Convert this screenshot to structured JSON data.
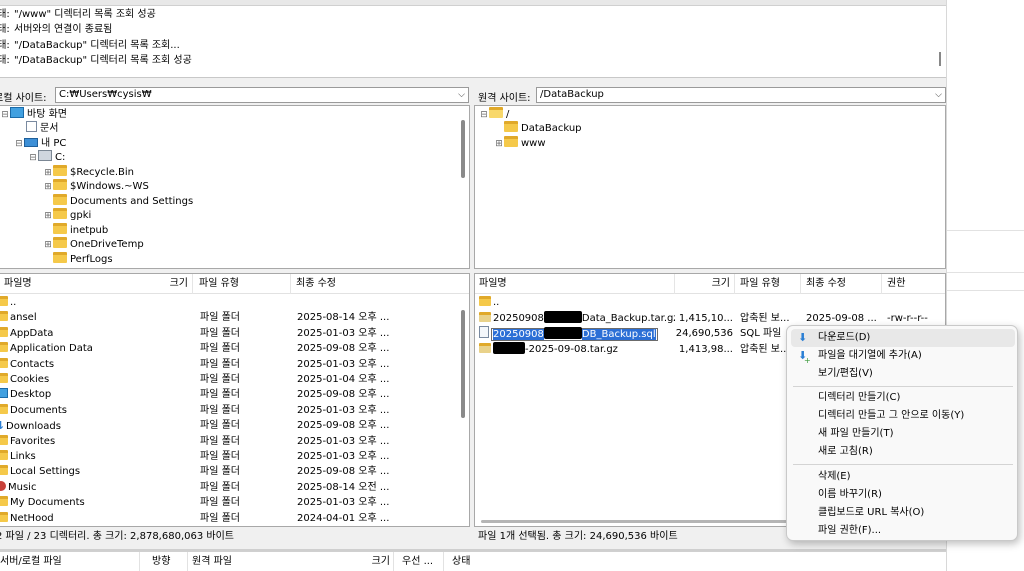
{
  "message_log": {
    "entries": [
      {
        "label": "상태:",
        "text": "\"/www\" 디렉터리 목록 조회 성공"
      },
      {
        "label": "상태:",
        "text": "서버와의 연결이 종료됨"
      },
      {
        "label": "상태:",
        "text": "\"/DataBackup\" 디렉터리 목록 조회..."
      },
      {
        "label": "상태:",
        "text": "\"/DataBackup\" 디렉터리 목록 조회 성공"
      }
    ]
  },
  "local": {
    "site_label": "로컬 사이트:",
    "path": "C:₩Users₩cysis₩",
    "tree": [
      {
        "label": "바탕 화면",
        "icon": "desktop-icon"
      },
      {
        "label": "문서",
        "icon": "document-icon"
      },
      {
        "label": "내 PC",
        "icon": "pc-icon"
      },
      {
        "label": "C:",
        "icon": "drive-icon"
      },
      {
        "label": "$Recycle.Bin",
        "icon": "folder-icon"
      },
      {
        "label": "$Windows.~WS",
        "icon": "folder-icon"
      },
      {
        "label": "Documents and Settings",
        "icon": "folder-shortcut-icon"
      },
      {
        "label": "gpki",
        "icon": "folder-icon"
      },
      {
        "label": "inetpub",
        "icon": "folder-icon"
      },
      {
        "label": "OneDriveTemp",
        "icon": "folder-icon"
      },
      {
        "label": "PerfLogs",
        "icon": "folder-icon"
      }
    ],
    "columns": {
      "name": "파일명",
      "size": "크기",
      "type": "파일 유형",
      "modified": "최종 수정"
    },
    "files": [
      {
        "name": "..",
        "type": "",
        "modified": "",
        "icon": "folder-icon"
      },
      {
        "name": "ansel",
        "type": "파일 폴더",
        "modified": "2025-08-14 오후 ...",
        "icon": "folder-icon"
      },
      {
        "name": "AppData",
        "type": "파일 폴더",
        "modified": "2025-01-03 오후 ...",
        "icon": "folder-icon"
      },
      {
        "name": "Application Data",
        "type": "파일 폴더",
        "modified": "2025-09-08 오후 ...",
        "icon": "folder-icon"
      },
      {
        "name": "Contacts",
        "type": "파일 폴더",
        "modified": "2025-01-03 오후 ...",
        "icon": "folder-icon"
      },
      {
        "name": "Cookies",
        "type": "파일 폴더",
        "modified": "2025-01-04 오후 ...",
        "icon": "folder-icon"
      },
      {
        "name": "Desktop",
        "type": "파일 폴더",
        "modified": "2025-09-08 오후 ...",
        "icon": "desktop-icon"
      },
      {
        "name": "Documents",
        "type": "파일 폴더",
        "modified": "2025-01-03 오후 ...",
        "icon": "folder-icon"
      },
      {
        "name": "Downloads",
        "type": "파일 폴더",
        "modified": "2025-09-08 오후 ...",
        "icon": "download-icon"
      },
      {
        "name": "Favorites",
        "type": "파일 폴더",
        "modified": "2025-01-03 오후 ...",
        "icon": "folder-icon"
      },
      {
        "name": "Links",
        "type": "파일 폴더",
        "modified": "2025-01-03 오후 ...",
        "icon": "folder-icon"
      },
      {
        "name": "Local Settings",
        "type": "파일 폴더",
        "modified": "2025-09-08 오후 ...",
        "icon": "folder-icon"
      },
      {
        "name": "Music",
        "type": "파일 폴더",
        "modified": "2025-08-14 오전 ...",
        "icon": "music-icon"
      },
      {
        "name": "My Documents",
        "type": "파일 폴더",
        "modified": "2025-01-03 오후 ...",
        "icon": "folder-icon"
      },
      {
        "name": "NetHood",
        "type": "파일 폴더",
        "modified": "2024-04-01 오후 ...",
        "icon": "folder-icon"
      }
    ],
    "status": "2 파일 / 23 디렉터리. 총 크기: 2,878,680,063 바이트"
  },
  "remote": {
    "site_label": "원격 사이트:",
    "path": "/DataBackup",
    "tree": [
      {
        "label": "/",
        "icon": "folder-open-icon"
      },
      {
        "label": "DataBackup",
        "icon": "folder-icon"
      },
      {
        "label": "www",
        "icon": "folder-icon"
      }
    ],
    "columns": {
      "name": "파일명",
      "size": "크기",
      "type": "파일 유형",
      "modified": "최종 수정",
      "perms": "권한"
    },
    "files": [
      {
        "name_prefix": "",
        "name_suffix": "..",
        "size": "",
        "type": "",
        "modified": "",
        "perms": "",
        "icon": "folder-icon"
      },
      {
        "name_prefix": "20250908",
        "name_suffix": "Data_Backup.tar.gz",
        "size": "1,415,10...",
        "type": "압축된 보...",
        "modified": "2025-09-08 ...",
        "perms": "-rw-r--r--",
        "icon": "archive-icon"
      },
      {
        "name_prefix": "20250908",
        "name_suffix": "DB_Backup.sql",
        "size": "24,690,536",
        "type": "SQL 파일",
        "modified": "",
        "perms": "",
        "icon": "file-icon"
      },
      {
        "name_prefix": "",
        "name_suffix": "-2025-09-08.tar.gz",
        "size": "1,413,98...",
        "type": "압축된 보...",
        "modified": "",
        "perms": "",
        "icon": "archive-icon"
      }
    ],
    "status": "파일 1개 선택됨. 총 크기: 24,690,536 바이트"
  },
  "queue": {
    "columns": [
      "서버/로컬 파일",
      "방향",
      "원격 파일",
      "크기",
      "우선 ...",
      "상태"
    ]
  },
  "context_menu": {
    "items": [
      {
        "label": "다운로드(D)",
        "icon": "download-arrow-icon"
      },
      {
        "label": "파일을 대기열에 추가(A)",
        "icon": "add-queue-icon"
      },
      {
        "label": "보기/편집(V)",
        "icon": ""
      },
      {
        "label": "디렉터리 만들기(C)",
        "icon": ""
      },
      {
        "label": "디렉터리 만들고 그 안으로 이동(Y)",
        "icon": ""
      },
      {
        "label": "새 파일 만들기(T)",
        "icon": ""
      },
      {
        "label": "새로 고침(R)",
        "icon": ""
      },
      {
        "label": "삭제(E)",
        "icon": ""
      },
      {
        "label": "이름 바꾸기(R)",
        "icon": ""
      },
      {
        "label": "클립보드로 URL 복사(O)",
        "icon": ""
      },
      {
        "label": "파일 권한(F)...",
        "icon": ""
      }
    ]
  },
  "colors": {
    "selection": "#2b6fd6",
    "folder": "#f5c94a",
    "menu_bg": "#f9f9f9"
  }
}
